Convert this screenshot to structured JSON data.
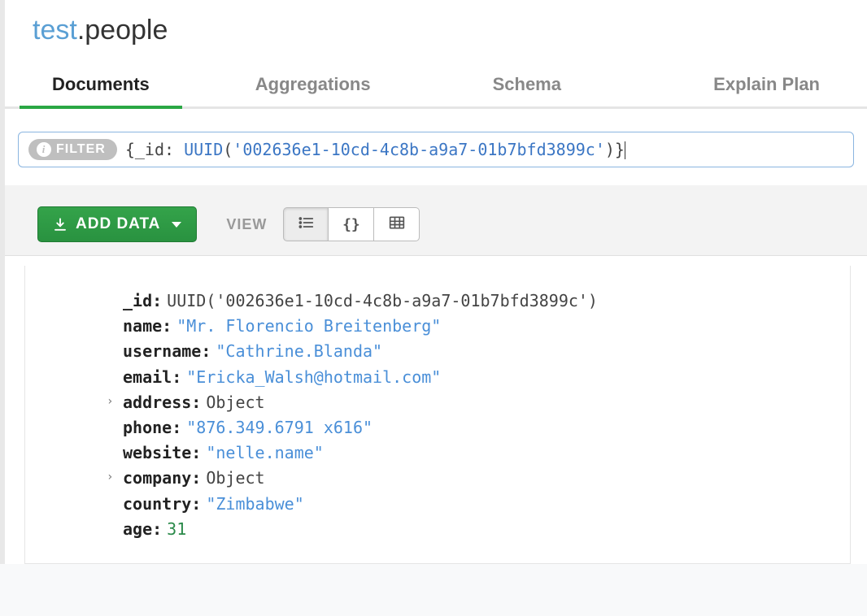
{
  "header": {
    "database": "test",
    "collection": ".people"
  },
  "tabs": [
    {
      "label": "Documents",
      "active": true
    },
    {
      "label": "Aggregations",
      "active": false
    },
    {
      "label": "Schema",
      "active": false
    },
    {
      "label": "Explain Plan",
      "active": false
    }
  ],
  "filter": {
    "chip_label": "FILTER",
    "query_brace_open": "{",
    "query_key": "_id:",
    "query_func": "UUID",
    "query_paren_open": "(",
    "query_str": "'002636e1-10cd-4c8b-a9a7-01b7bfd3899c'",
    "query_paren_close": ")",
    "query_brace_close": "}"
  },
  "toolbar": {
    "add_label": "ADD DATA",
    "view_label": "VIEW"
  },
  "document": {
    "fields": [
      {
        "key": "_id",
        "type": "raw",
        "value": "UUID('002636e1-10cd-4c8b-a9a7-01b7bfd3899c')",
        "expandable": false
      },
      {
        "key": "name",
        "type": "string",
        "value": "\"Mr. Florencio Breitenberg\"",
        "expandable": false
      },
      {
        "key": "username",
        "type": "string",
        "value": "\"Cathrine.Blanda\"",
        "expandable": false
      },
      {
        "key": "email",
        "type": "string",
        "value": "\"Ericka_Walsh@hotmail.com\"",
        "expandable": false
      },
      {
        "key": "address",
        "type": "object",
        "value": "Object",
        "expandable": true
      },
      {
        "key": "phone",
        "type": "string",
        "value": "\"876.349.6791 x616\"",
        "expandable": false
      },
      {
        "key": "website",
        "type": "string",
        "value": "\"nelle.name\"",
        "expandable": false
      },
      {
        "key": "company",
        "type": "object",
        "value": "Object",
        "expandable": true
      },
      {
        "key": "country",
        "type": "string",
        "value": "\"Zimbabwe\"",
        "expandable": false
      },
      {
        "key": "age",
        "type": "number",
        "value": "31",
        "expandable": false
      }
    ]
  }
}
